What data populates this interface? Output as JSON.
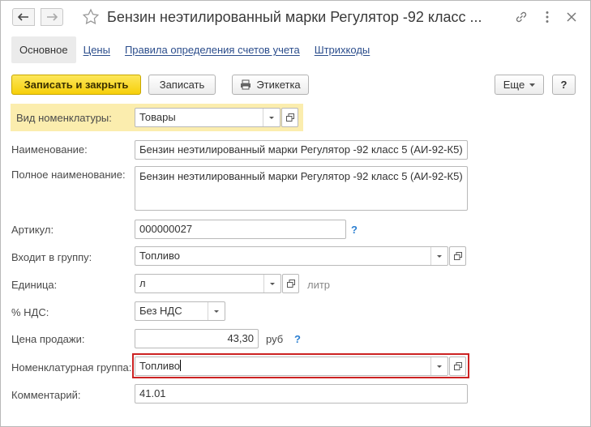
{
  "title": "Бензин неэтилированный марки Регулятор -92 класс ...",
  "tabs": [
    {
      "label": "Основное"
    },
    {
      "label": "Цены"
    },
    {
      "label": "Правила определения счетов учета"
    },
    {
      "label": "Штрихкоды"
    }
  ],
  "toolbar": {
    "save_close_label": "Записать и закрыть",
    "save_label": "Записать",
    "label_button": "Этикетка",
    "more_label": "Еще",
    "help_label": "?"
  },
  "form": {
    "item_type": {
      "label": "Вид номенклатуры:",
      "value": "Товары"
    },
    "name": {
      "label": "Наименование:",
      "value": "Бензин неэтилированный марки Регулятор -92 класс 5 (АИ-92-К5)"
    },
    "full_name": {
      "label": "Полное наименование:",
      "value": "Бензин неэтилированный марки Регулятор -92 класс 5 (АИ-92-К5)"
    },
    "article": {
      "label": "Артикул:",
      "value": "000000027",
      "help": "?"
    },
    "group": {
      "label": "Входит в группу:",
      "value": "Топливо"
    },
    "unit": {
      "label": "Единица:",
      "value": "л",
      "hint": "литр"
    },
    "vat": {
      "label": "% НДС:",
      "value": "Без НДС"
    },
    "price": {
      "label": "Цена продажи:",
      "value": "43,30",
      "currency": "руб",
      "help": "?"
    },
    "nomenclature_group": {
      "label": "Номенклатурная группа:",
      "value": "Топливо"
    },
    "comment": {
      "label": "Комментарий:",
      "value": "41.01"
    }
  },
  "colors": {
    "primary_button": "#f6cf0a",
    "highlight_row": "#fbedae",
    "focus_border": "#cc2222",
    "link": "#2b4d8c",
    "help": "#2b7fd1"
  }
}
